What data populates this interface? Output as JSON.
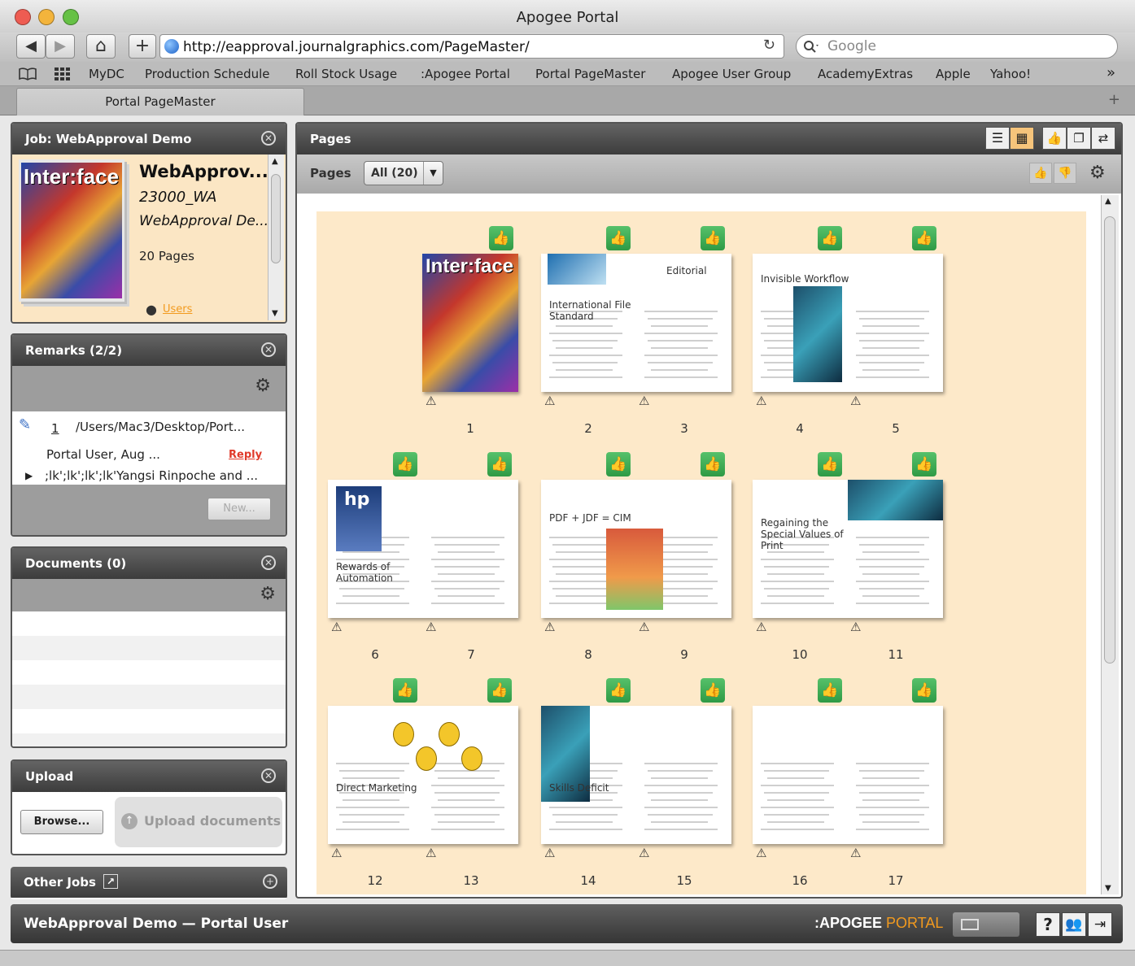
{
  "window": {
    "title": "Apogee Portal"
  },
  "toolbar": {
    "back": "◀",
    "forward": "▶",
    "home": "⌂",
    "add": "+",
    "url": "http://eapproval.journalgraphics.com/PageMaster/",
    "reload": "↻",
    "search_placeholder": "Google"
  },
  "bookmarks": [
    "MyDC",
    "Production Schedule",
    "Roll Stock Usage",
    ":Apogee Portal",
    "Portal PageMaster",
    "Apogee User Group",
    "AcademyExtras",
    "Apple",
    "Yahoo!"
  ],
  "tab": {
    "label": "Portal PageMaster",
    "add": "+"
  },
  "job_panel": {
    "title": "Job: WebApproval Demo",
    "cover_title": "Inter:face",
    "name": "WebApprov...",
    "job_id": "23000_WA",
    "desc": "WebApproval De...",
    "pages": "20 Pages",
    "users": "Users"
  },
  "remarks_panel": {
    "title": "Remarks (2/2)",
    "number": "1",
    "path": "/Users/Mac3/Desktop/Port...",
    "author": "Portal User, Aug ...",
    "reply": "Reply",
    "text": ";lk';lk';lk';lk'Yangsi Rinpoche and ...",
    "new_button": "New..."
  },
  "documents_panel": {
    "title": "Documents (0)"
  },
  "upload_panel": {
    "title": "Upload",
    "browse": "Browse...",
    "upload": "Upload documents"
  },
  "other_jobs": {
    "title": "Other Jobs"
  },
  "pages_panel": {
    "title": "Pages",
    "filter_label": "Pages",
    "filter_value": "All (20)"
  },
  "spreads": [
    {
      "pages": [
        "1"
      ],
      "headline": "Inter:face"
    },
    {
      "pages": [
        "2",
        "3"
      ],
      "headline": "International File Standard",
      "headline2": "Editorial"
    },
    {
      "pages": [
        "4",
        "5"
      ],
      "headline": "Invisible Workflow"
    },
    {
      "pages": [
        "6",
        "7"
      ],
      "headline": "Rewards of Automation",
      "logo": "hp"
    },
    {
      "pages": [
        "8",
        "9"
      ],
      "headline": "PDF + JDF = CIM"
    },
    {
      "pages": [
        "10",
        "11"
      ],
      "headline": "Regaining the Special Values of Print"
    },
    {
      "pages": [
        "12",
        "13"
      ],
      "headline": "Direct Marketing"
    },
    {
      "pages": [
        "14",
        "15"
      ],
      "headline": "Skills Deficit"
    },
    {
      "pages": [
        "16",
        "17"
      ],
      "headline": ""
    }
  ],
  "footer": {
    "title": "WebApproval Demo — Portal User",
    "brand_a": ":APOGEE",
    "brand_b": "PORTAL",
    "help": "?"
  },
  "colors": {
    "approve_green": "#3aa851",
    "canvas": "#fde9c9",
    "header_dark": "#3c3c3c",
    "reply_red": "#e03a2a",
    "brand_orange": "#f29a1e"
  }
}
